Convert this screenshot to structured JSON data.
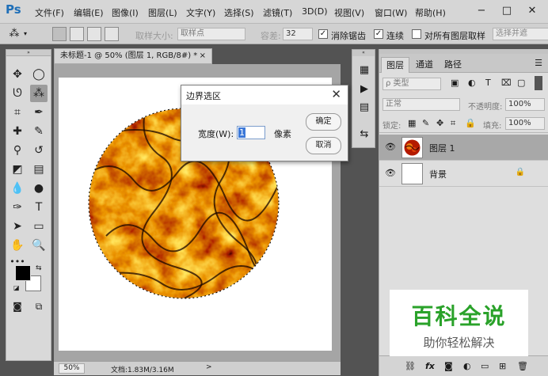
{
  "app": {
    "logo": "Ps"
  },
  "menubar": {
    "items": [
      "文件(F)",
      "编辑(E)",
      "图像(I)",
      "图层(L)",
      "文字(Y)",
      "选择(S)",
      "滤镜(T)",
      "3D(D)",
      "视图(V)",
      "窗口(W)",
      "帮助(H)"
    ],
    "window_controls": [
      "−",
      "□",
      "✕"
    ]
  },
  "options_bar": {
    "sample_size_label": "取样大小:",
    "sample_size_value": "取样点",
    "tolerance_label": "容差:",
    "tolerance_value": "32",
    "antialias_label": "消除锯齿",
    "antialias_checked": true,
    "contiguous_label": "连续",
    "contiguous_checked": true,
    "all_layers_label": "对所有图层取样",
    "all_layers_checked": false,
    "select_subject_label": "选择并遮"
  },
  "document": {
    "tab_title": "未标题-1 @ 50% (图层 1, RGB/8#) *",
    "tab_close": "×",
    "zoom": "50%",
    "doc_size": "文档:1.83M/3.16M",
    "status_arrow": ">"
  },
  "dialog": {
    "title": "边界选区",
    "close": "✕",
    "width_label": "宽度(W):",
    "width_value": "1",
    "unit": "像素",
    "ok_label": "确定",
    "cancel_label": "取消"
  },
  "layers_panel": {
    "tabs": [
      "图层",
      "通道",
      "路径"
    ],
    "active_tab": 0,
    "filter_label": "ρ 类型",
    "blend_mode": "正常",
    "opacity_label": "不透明度:",
    "opacity_value": "100%",
    "lock_label": "锁定:",
    "fill_label": "填充:",
    "fill_value": "100%",
    "layers": [
      {
        "name": "图层 1",
        "selected": true
      },
      {
        "name": "背景",
        "selected": false
      }
    ],
    "bottom_icons": [
      "link-icon",
      "fx-icon",
      "mask-icon",
      "adjustment-icon",
      "folder-icon",
      "new-layer-icon",
      "trash-icon"
    ],
    "bottom_fx": "fx"
  },
  "watermark": {
    "title": "百科全说",
    "subtitle": "助你轻松解决"
  },
  "colors": {
    "foreground": "#000000",
    "background": "#ffffff",
    "accent": "#3c78d8",
    "watermark_green": "#2aa22a"
  }
}
